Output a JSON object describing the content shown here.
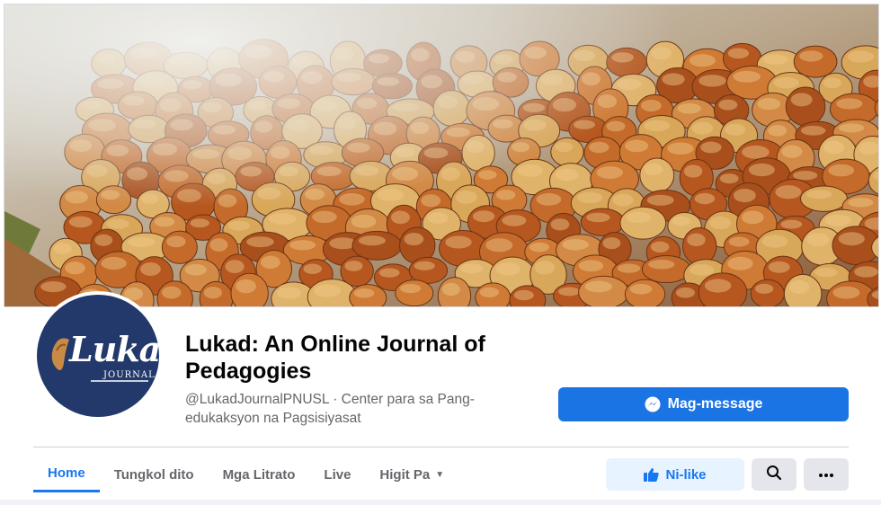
{
  "page": {
    "title": "Lukad: An Online Journal of Pedagogies",
    "handle": "@LukadJournalPNUSL · Center para sa Pang-edukaksyon na Pagsisiyasat",
    "logo": {
      "word": "Lukad",
      "sub": "JOURNAL"
    },
    "cover_description_colors": {
      "shell": "#c46a2a",
      "husk": "#d9a75a",
      "smoke": "#e9e9e6"
    }
  },
  "actions": {
    "message_label": "Mag-message",
    "like_label": "Ni-like"
  },
  "tabs": [
    {
      "label": "Home",
      "active": true
    },
    {
      "label": "Tungkol dito",
      "active": false
    },
    {
      "label": "Mga Litrato",
      "active": false
    },
    {
      "label": "Live",
      "active": false
    },
    {
      "label": "Higit Pa",
      "active": false,
      "has_caret": true
    }
  ],
  "icons": {
    "messenger": "messenger-icon",
    "like": "thumbs-up-icon",
    "search": "search-icon",
    "more": "more-dots-icon",
    "caret": "caret-down-icon"
  },
  "colors": {
    "accent": "#1877f2",
    "button_primary": "#1b74e4",
    "like_bg": "#e7f3ff",
    "secondary_bg": "#e4e6eb",
    "logo_bg": "#23396b"
  }
}
